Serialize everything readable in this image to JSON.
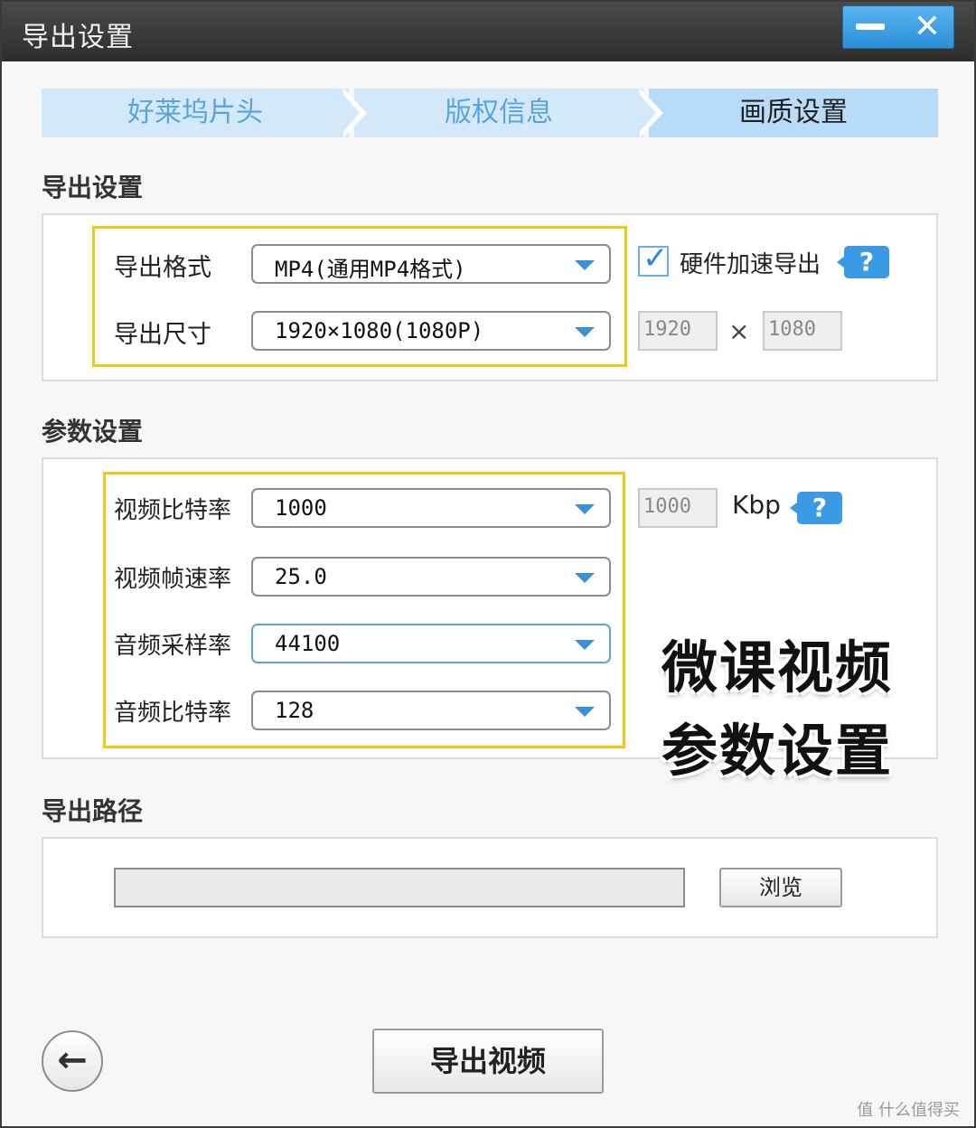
{
  "window": {
    "title": "导出设置",
    "minimize_icon": "minimize-icon",
    "close_glyph": "✕"
  },
  "steps": [
    {
      "label": "好莱坞片头",
      "active": false
    },
    {
      "label": "版权信息",
      "active": false
    },
    {
      "label": "画质设置",
      "active": true
    }
  ],
  "export_settings": {
    "section_title": "导出设置",
    "format_label": "导出格式",
    "format_value": "MP4(通用MP4格式)",
    "size_label": "导出尺寸",
    "size_value": "1920×1080(1080P)",
    "hw_accel_label": "硬件加速导出",
    "hw_accel_checked": true,
    "width_value": "1920",
    "height_value": "1080",
    "times_glyph": "×",
    "help_glyph": "?"
  },
  "param_settings": {
    "section_title": "参数设置",
    "video_bitrate_label": "视频比特率",
    "video_bitrate_value": "1000",
    "video_bitrate_readonly": "1000",
    "bitrate_unit": "Kbp",
    "help_glyph": "?",
    "frame_rate_label": "视频帧速率",
    "frame_rate_value": "25.0",
    "sample_rate_label": "音频采样率",
    "sample_rate_value": "44100",
    "audio_bitrate_label": "音频比特率",
    "audio_bitrate_value": "128"
  },
  "overlay": {
    "line1": "微课视频",
    "line2": "参数设置"
  },
  "export_path": {
    "section_title": "导出路径",
    "path_value": "",
    "browse_label": "浏览"
  },
  "footer": {
    "back_glyph": "←",
    "export_label": "导出视频"
  },
  "watermark": "值 什么值得买",
  "colors": {
    "accent": "#3a9be4",
    "highlight": "#f5c518",
    "tab_bg": "#d3e9fa"
  }
}
